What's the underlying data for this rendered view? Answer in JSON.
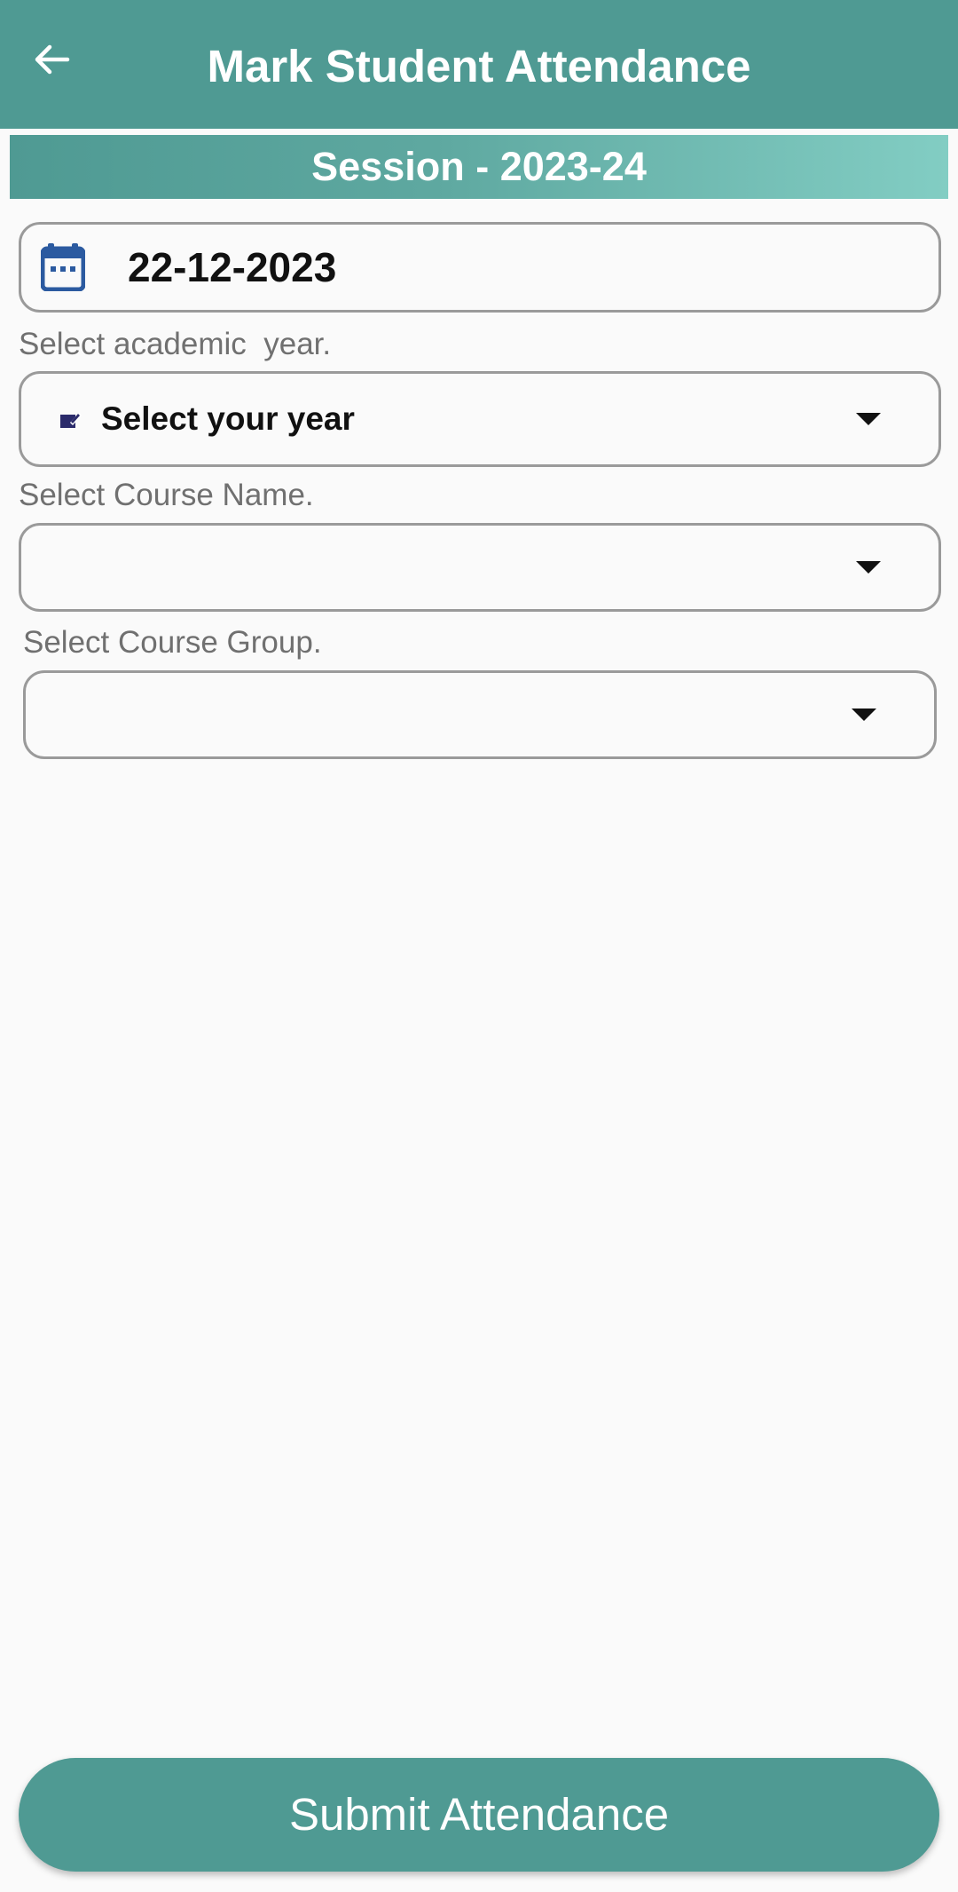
{
  "header": {
    "title": "Mark Student Attendance",
    "back_icon": "arrow-left-icon"
  },
  "session": {
    "label": "Session - 2023-24"
  },
  "date_field": {
    "icon": "calendar-icon",
    "value": "22-12-2023"
  },
  "academic_year": {
    "label": "Select academic  year.",
    "icon": "edit-note-icon",
    "selected": "Select your year"
  },
  "course_name": {
    "label": "Select Course Name.",
    "selected": ""
  },
  "course_group": {
    "label": "Select Course Group.",
    "selected": ""
  },
  "footer": {
    "submit_label": "Submit Attendance"
  },
  "colors": {
    "primary": "#4f9a93",
    "banner_gradient_end": "#82cdc3",
    "calendar_icon": "#2b5aa0",
    "background": "#fafafa"
  }
}
